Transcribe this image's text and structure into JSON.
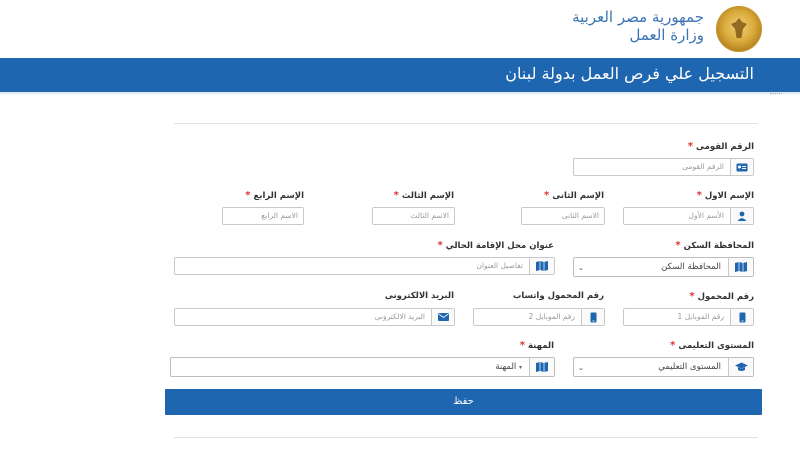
{
  "header": {
    "line1": "جمهورية مصر العربية",
    "line2": "وزارة العمل",
    "logo_icon": "egypt-eagle-emblem-icon"
  },
  "banner": {
    "title": "التسجيل علي فرص العمل بدولة لبنان"
  },
  "form": {
    "required_mark": "*",
    "national_id": {
      "label": "الرقم القومى",
      "placeholder": "الرقم القومى",
      "icon": "id-card-icon"
    },
    "first_name": {
      "label": "الإسم الاول",
      "placeholder": "الأسم الأول",
      "icon": "user-icon"
    },
    "second_name": {
      "label": "الإسم الثانى",
      "placeholder": "الاسم الثانى"
    },
    "third_name": {
      "label": "الإسم الثالث",
      "placeholder": "الاسم الثالث"
    },
    "fourth_name": {
      "label": "الإسم الرابع",
      "placeholder": "الاسم الرابع"
    },
    "governorate": {
      "label": "المحافظة السكن",
      "value": "المحافظة السكن",
      "icon": "map-icon"
    },
    "address": {
      "label": "عنوان محل الإقامة الحالي",
      "placeholder": "تفاصيل العنوان",
      "icon": "map-icon"
    },
    "mobile": {
      "label": "رقم المحمول",
      "placeholder": "رقم الموبايل 1",
      "icon": "mobile-icon"
    },
    "whatsapp": {
      "label": "رقم المحمول واتساب",
      "placeholder": "رقم الموبايل 2",
      "icon": "mobile-icon"
    },
    "email": {
      "label": "البريد الالكترونى",
      "placeholder": "البريد الالكترونى",
      "icon": "envelope-icon"
    },
    "education": {
      "label": "المستوى التعليمى",
      "value": "المستوى التعليمي",
      "icon": "graduation-cap-icon"
    },
    "profession": {
      "label": "المهنة",
      "value": "المهنة",
      "icon": "map-icon"
    },
    "save_label": "حفظ"
  },
  "colors": {
    "primary": "#1f66b0",
    "required": "#d9342b",
    "header_text": "#3c74b5"
  }
}
